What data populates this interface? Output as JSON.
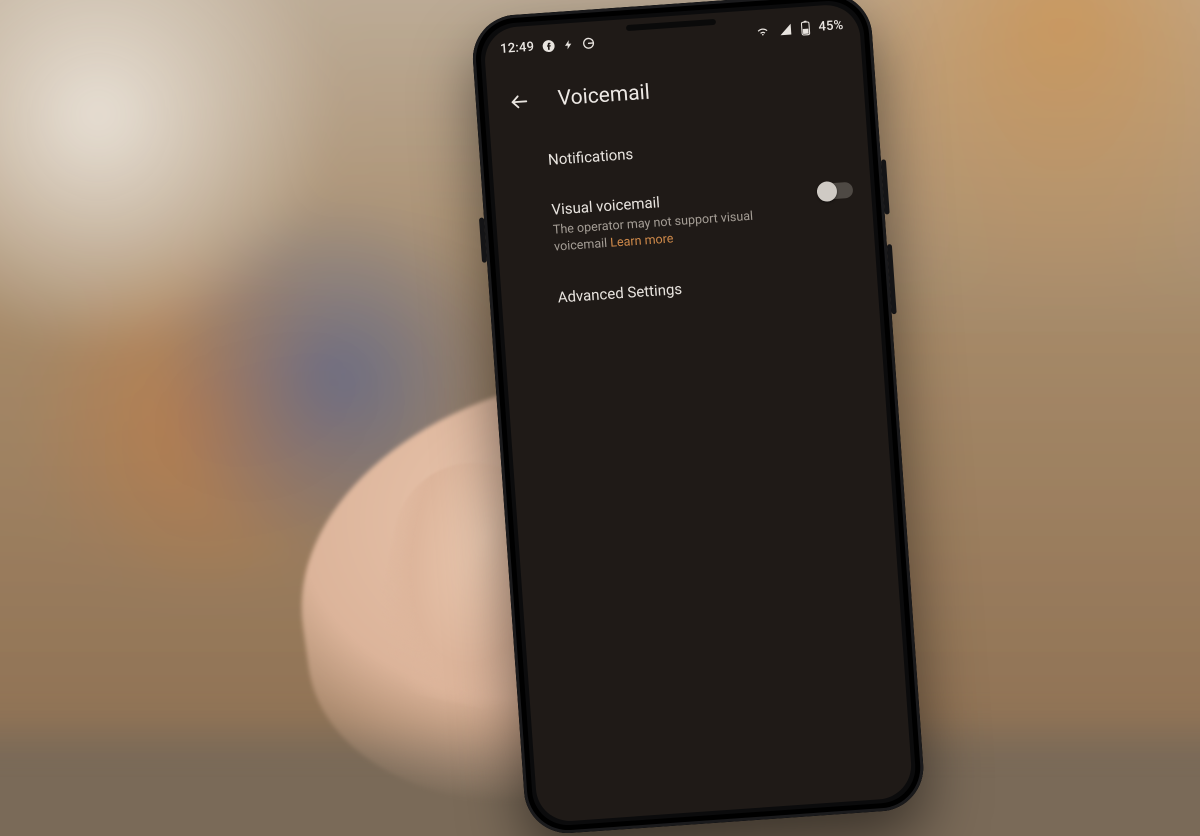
{
  "statusbar": {
    "time": "12:49",
    "battery_text": "45%",
    "icons_left": [
      "facebook",
      "bolt",
      "google"
    ],
    "icons_right": [
      "wifi",
      "signal",
      "battery"
    ]
  },
  "header": {
    "title": "Voicemail"
  },
  "rows": {
    "notifications": {
      "label": "Notifications"
    },
    "visual_voicemail": {
      "label": "Visual voicemail",
      "desc_prefix": "The operator may not support visual voicemail ",
      "learn_more": "Learn more",
      "toggle_on": false
    },
    "advanced": {
      "label": "Advanced Settings"
    }
  },
  "colors": {
    "accent_link": "#d08a4a",
    "screen_bg": "#1f1a17"
  }
}
